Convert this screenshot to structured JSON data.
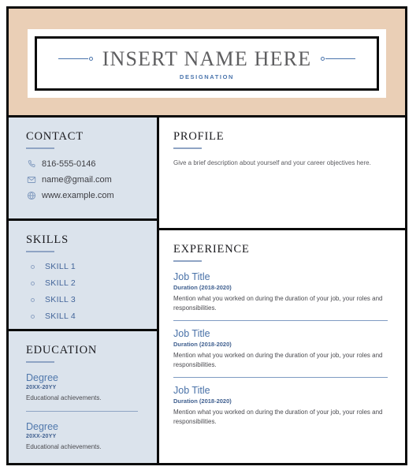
{
  "document": {
    "type": "resume-template",
    "colors": {
      "header_band": "#EACFB6",
      "sidebar": "#DBE3EC",
      "accent_blue": "#4A72A8",
      "rule_blue": "#8FA4C4",
      "border_black": "#0B0B0B"
    }
  },
  "header": {
    "name": "INSERT NAME HERE",
    "designation": "DESIGNATION"
  },
  "contact": {
    "title": "CONTACT",
    "items": [
      {
        "icon": "phone-icon",
        "value": "816-555-0146"
      },
      {
        "icon": "envelope-icon",
        "value": "name@gmail.com"
      },
      {
        "icon": "globe-icon",
        "value": "www.example.com"
      }
    ]
  },
  "skills": {
    "title": "SKILLS",
    "items": [
      "SKILL 1",
      "SKILL 2",
      "SKILL 3",
      "SKILL 4"
    ]
  },
  "education": {
    "title": "EDUCATION",
    "entries": [
      {
        "degree": "Degree",
        "years": "20XX-20YY",
        "achievements": "Educational achievements."
      },
      {
        "degree": "Degree",
        "years": "20XX-20YY",
        "achievements": " Educational achievements."
      }
    ]
  },
  "profile": {
    "title": "PROFILE",
    "description": "Give a brief description about yourself and your career objectives here."
  },
  "experience": {
    "title": "EXPERIENCE",
    "entries": [
      {
        "job_title": "Job Title",
        "duration": "Duration (2018-2020)",
        "description": "Mention what you worked on during the duration of your job, your roles and responsibilities."
      },
      {
        "job_title": "Job Title",
        "duration": "Duration (2018-2020)",
        "description": " Mention what you worked on during the duration of your job, your roles and responsibilities."
      },
      {
        "job_title": "Job Title",
        "duration": "Duration (2018-2020)",
        "description": " Mention what you worked on during the duration of your job, your roles and responsibilities."
      }
    ]
  }
}
